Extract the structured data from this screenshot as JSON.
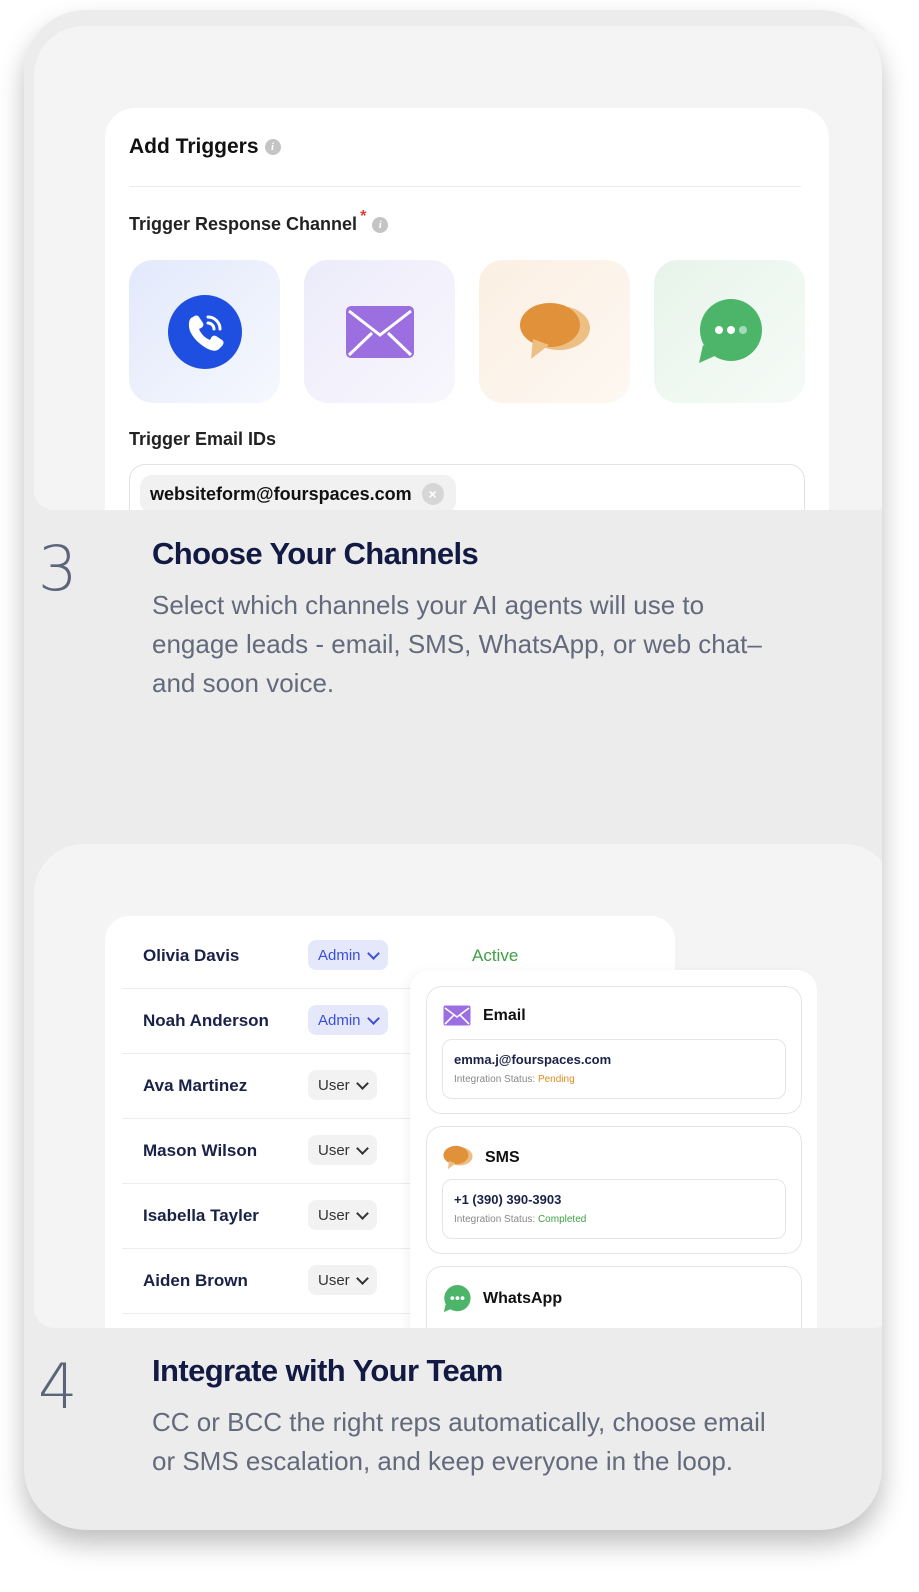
{
  "step3": {
    "number": "3",
    "title": "Choose Your Channels",
    "description": "Select which channels your AI agents will use to engage leads - email, SMS, WhatsApp, or web chat–and soon voice."
  },
  "triggers_card": {
    "title": "Add Triggers",
    "channel_label": "Trigger Response Channel",
    "required_mark": "*",
    "channels": [
      {
        "icon": "phone-icon",
        "color": "#1e4fe0"
      },
      {
        "icon": "mail-icon",
        "color": "#9b6fe0"
      },
      {
        "icon": "sms-icon",
        "color": "#e0913a"
      },
      {
        "icon": "chat-icon",
        "color": "#4db56a"
      }
    ],
    "email_ids_label": "Trigger Email IDs",
    "email_chip": "websiteform@fourspaces.com",
    "chip_remove": "×"
  },
  "step4": {
    "number": "4",
    "title": "Integrate with Your Team",
    "description": "CC or BCC the right reps automatically, choose email or SMS escalation, and keep everyone in the loop."
  },
  "team": {
    "members": [
      {
        "name": "Olivia Davis",
        "role": "Admin"
      },
      {
        "name": "Noah Anderson",
        "role": "Admin"
      },
      {
        "name": "Ava Martinez",
        "role": "User"
      },
      {
        "name": "Mason Wilson",
        "role": "User"
      },
      {
        "name": "Isabella Tayler",
        "role": "User"
      },
      {
        "name": "Aiden Brown",
        "role": "User"
      }
    ],
    "status_label": "Active"
  },
  "integrations": {
    "status_prefix": "Integration Status:",
    "items": [
      {
        "name": "Email",
        "value": "emma.j@fourspaces.com",
        "status": "Pending",
        "icon": "mail-icon"
      },
      {
        "name": "SMS",
        "value": "+1 (390) 390-3903",
        "status": "Completed",
        "icon": "sms-icon"
      },
      {
        "name": "WhatsApp",
        "icon": "whatsapp-icon"
      }
    ]
  },
  "colors": {
    "navy": "#121a43",
    "accent_blue": "#3a4fd8",
    "active_green": "#3fa043",
    "pending_orange": "#e08a1e"
  }
}
